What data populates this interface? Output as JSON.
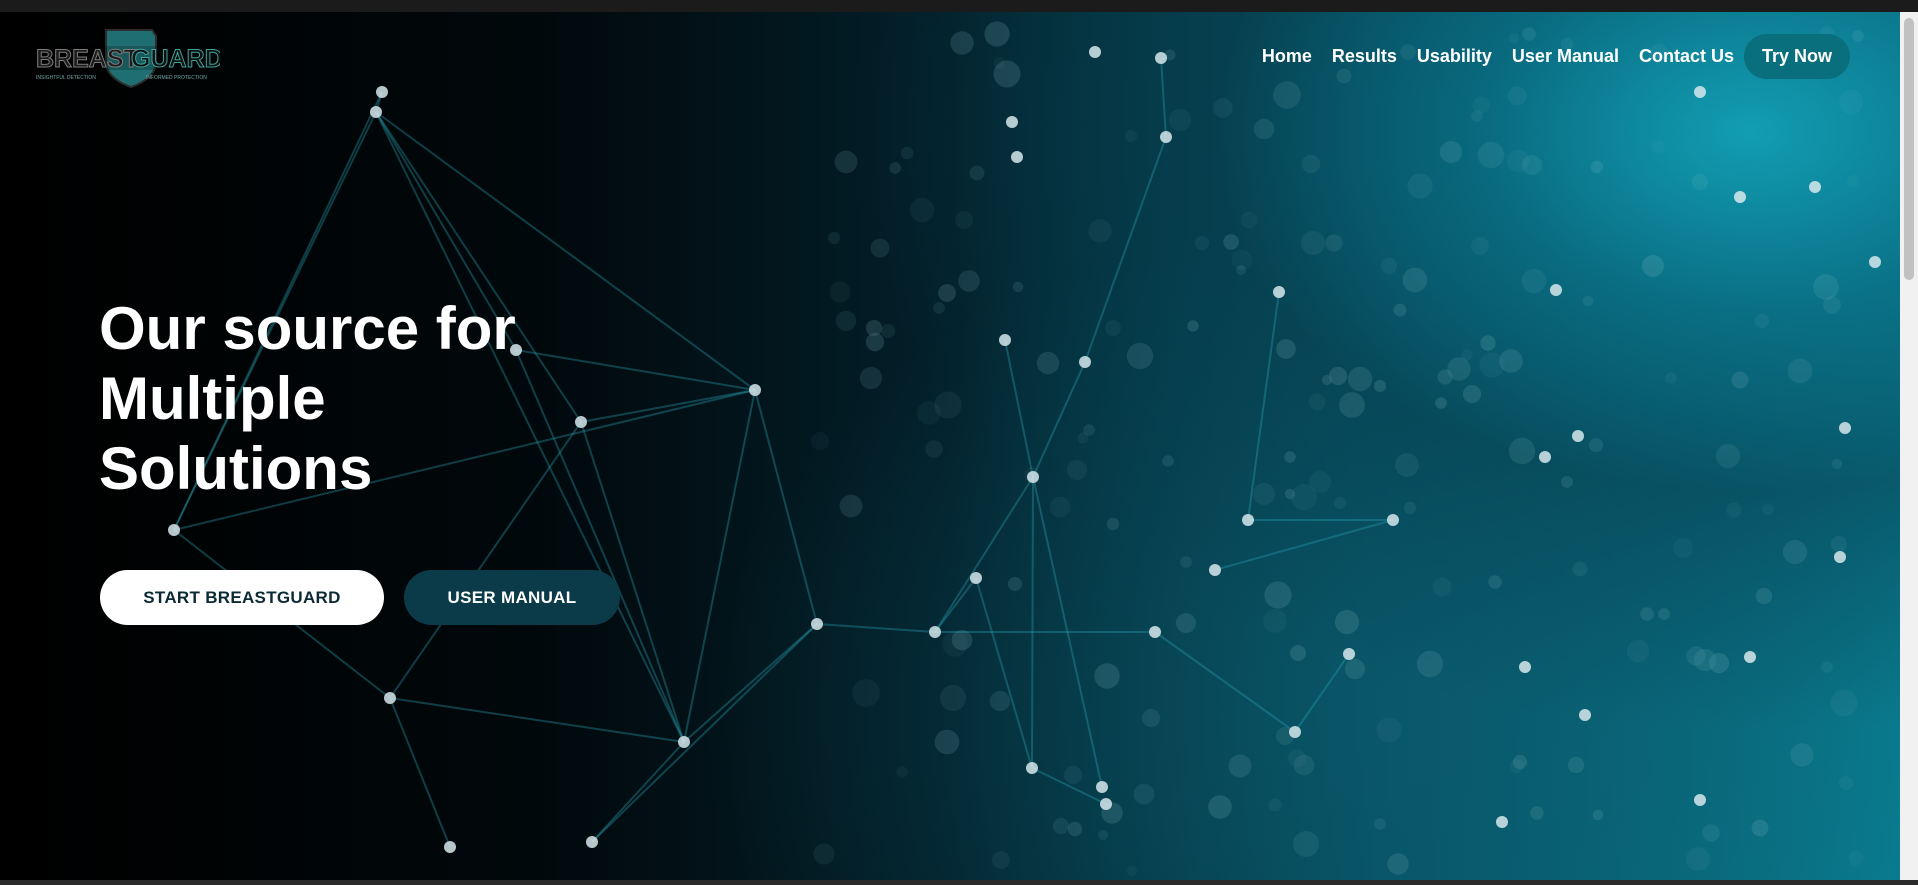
{
  "brand": {
    "logo_word_1": "BREAST",
    "logo_word_2": "GUARD",
    "tagline_left": "INSIGHTFUL DETECTION",
    "tagline_right": "INFORMED PROTECTION",
    "logo_icon": "shield-icon"
  },
  "nav": {
    "items": [
      "Home",
      "Results",
      "Usability",
      "User Manual",
      "Contact Us"
    ],
    "cta": "Try Now"
  },
  "hero": {
    "title_lines": [
      "Our source for",
      "Multiple",
      "Solutions"
    ],
    "primary_button": "START BREASTGUARD",
    "secondary_button": "USER MANUAL"
  },
  "colors": {
    "accent": "#0a6f7c",
    "secondary_button": "#0b3a48",
    "text": "#ffffff"
  }
}
